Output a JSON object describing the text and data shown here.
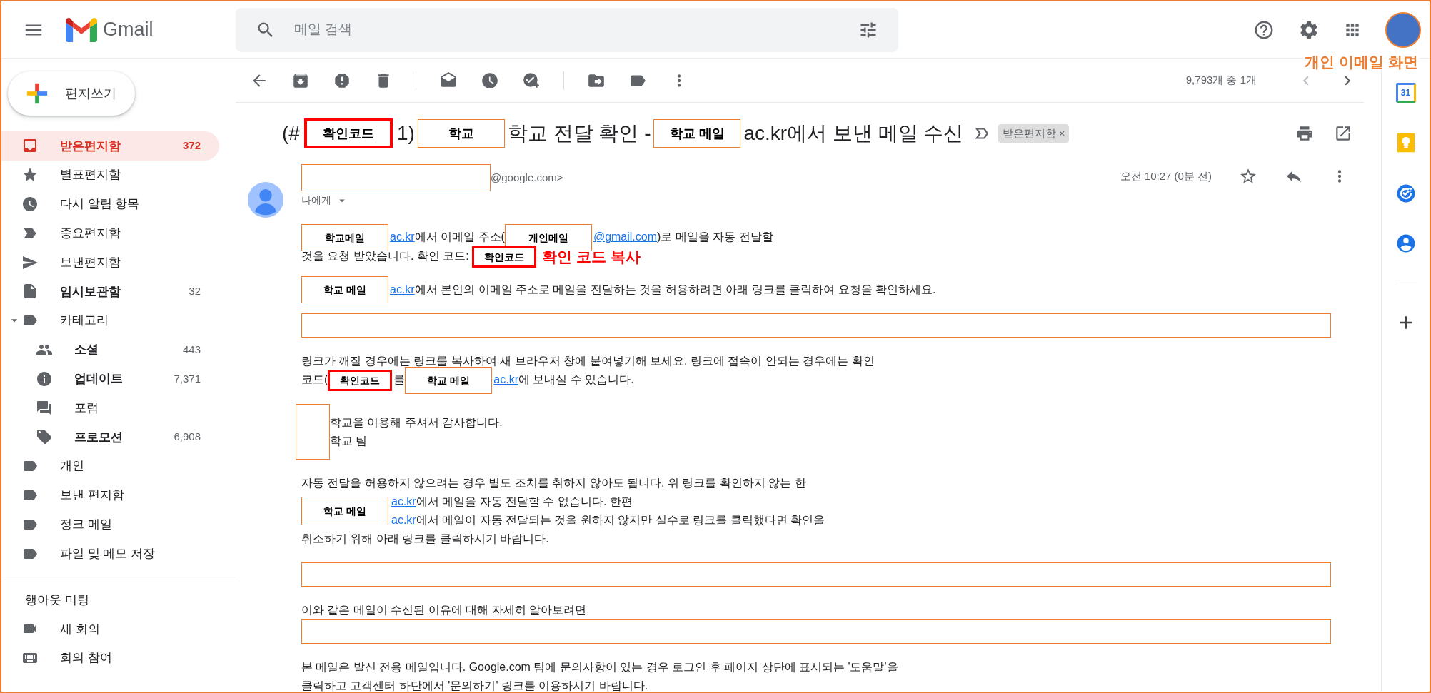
{
  "app": {
    "name": "Gmail"
  },
  "search": {
    "placeholder": "메일 검색"
  },
  "annotation": "개인 이메일 화면",
  "compose": "편지쓰기",
  "nav": [
    {
      "kind": "inbox",
      "label": "받은편지함",
      "count": "372",
      "selected": true,
      "unread": true
    },
    {
      "kind": "starred",
      "label": "별표편지함",
      "selected": false,
      "unread": false
    },
    {
      "kind": "snoozed",
      "label": "다시 알림 항목",
      "selected": false,
      "unread": false
    },
    {
      "kind": "important",
      "label": "중요편지함",
      "selected": false,
      "unread": false
    },
    {
      "kind": "sent",
      "label": "보낸편지함",
      "selected": false,
      "unread": false
    },
    {
      "kind": "drafts",
      "label": "임시보관함",
      "count": "32",
      "selected": false,
      "unread": true
    },
    {
      "kind": "category",
      "label": "카테고리",
      "selected": false,
      "unread": false,
      "expanded": true,
      "children": [
        {
          "kind": "social",
          "label": "소셜",
          "count": "443",
          "selected": false,
          "unread": true
        },
        {
          "kind": "updates",
          "label": "업데이트",
          "count": "7,371",
          "selected": false,
          "unread": true
        },
        {
          "kind": "forums",
          "label": "포럼",
          "selected": false,
          "unread": false
        },
        {
          "kind": "promotions",
          "label": "프로모션",
          "count": "6,908",
          "selected": false,
          "unread": true
        }
      ]
    },
    {
      "kind": "label",
      "label": "개인",
      "selected": false,
      "unread": false
    },
    {
      "kind": "label",
      "label": "보낸 편지함",
      "selected": false,
      "unread": false
    },
    {
      "kind": "label",
      "label": "정크 메일",
      "selected": false,
      "unread": false
    },
    {
      "kind": "label",
      "label": "파일 및 메모 저장",
      "selected": false,
      "unread": false
    }
  ],
  "meet": {
    "title": "행아웃 미팅",
    "items": [
      {
        "kind": "video",
        "label": "새 회의"
      },
      {
        "kind": "keyboard",
        "label": "회의 참여"
      }
    ]
  },
  "toolbar": {
    "count": "9,793개 중 1개"
  },
  "subject": {
    "pieces": [
      {
        "kind": "text",
        "text": "(#"
      },
      {
        "kind": "code",
        "text": "확인코드"
      },
      {
        "kind": "text",
        "text": "1)"
      },
      {
        "kind": "redact",
        "text": "학교"
      },
      {
        "kind": "text",
        "text": "학교 전달 확인 -"
      },
      {
        "kind": "redact",
        "text": "학교 메일"
      },
      {
        "kind": "text",
        "text": "ac.kr에서 보낸 메일 수신"
      }
    ],
    "chip": {
      "label": "받은편지함",
      "remove": "×"
    }
  },
  "message": {
    "sender": [
      {
        "kind": "blank"
      },
      {
        "kind": "text",
        "text": "@google.com>"
      }
    ],
    "to": "나에게",
    "time": "오전 10:27 (0분 전)",
    "starred": false
  },
  "calendar_day": "31",
  "paragraphs": [
    [
      {
        "kind": "lines",
        "lines": [
          [
            {
              "kind": "redact",
              "text": "학교메일"
            },
            {
              "kind": "link",
              "text": "ac.kr"
            },
            {
              "kind": "text",
              "text": "에서 이메일 주소("
            },
            {
              "kind": "redact",
              "text": "개인메일"
            },
            {
              "kind": "link",
              "text": "@gmail.com"
            },
            {
              "kind": "text",
              "text": ")로 메일을 자동 전달할"
            }
          ],
          [
            {
              "kind": "text",
              "text": "것을 요청 받았습니다. 확인 코드: "
            },
            {
              "kind": "code",
              "text": "확인코드"
            },
            {
              "kind": "note",
              "text": "확인 코드 복사"
            }
          ]
        ]
      }
    ],
    [
      {
        "kind": "lines",
        "lines": [
          [
            {
              "kind": "redact",
              "text": "학교 메일"
            },
            {
              "kind": "link",
              "text": "ac.kr"
            },
            {
              "kind": "text",
              "text": "에서 본인의 이메일 주소로 메일을 전달하는 것을 허용하려면 아래 링크를 클릭하여 요청을 확인하세요."
            }
          ]
        ]
      }
    ],
    [
      {
        "kind": "blank"
      }
    ],
    [
      {
        "kind": "lines",
        "lines": [
          [
            {
              "kind": "text",
              "text": "링크가 깨질 경우에는 링크를 복사하여 새 브라우저 창에 붙여넣기해 보세요. 링크에 접속이 안되는 경우에는 확인"
            }
          ],
          [
            {
              "kind": "text",
              "text": "코드("
            },
            {
              "kind": "code",
              "text": "확인코드"
            },
            {
              "kind": "text",
              "text": "를"
            },
            {
              "kind": "redact",
              "text": "학교 메일"
            },
            {
              "kind": "link",
              "text": "ac.kr"
            },
            {
              "kind": "text",
              "text": "에 보내실 수 있습니다."
            }
          ]
        ]
      }
    ],
    [
      {
        "kind": "side",
        "box": {
          "kind": "blank"
        },
        "lines": [
          [
            {
              "kind": "text",
              "text": "학교을 이용해 주셔서 감사합니다."
            }
          ],
          [
            {
              "kind": "text",
              "text": "학교 팀"
            }
          ]
        ]
      }
    ],
    [
      {
        "kind": "lines",
        "lines": [
          [
            {
              "kind": "text",
              "text": "자동 전달을 허용하지 않으려는 경우 별도 조치를 취하지 않아도 됩니다. 위 링크를 확인하지 않는 한"
            }
          ]
        ]
      },
      {
        "kind": "side",
        "box": {
          "kind": "redact",
          "text": "학교 메일"
        },
        "lines": [
          [
            {
              "kind": "link",
              "text": "ac.kr"
            },
            {
              "kind": "text",
              "text": "에서 메일을 자동 전달할 수 없습니다. 한편"
            }
          ],
          [
            {
              "kind": "link",
              "text": "ac.kr"
            },
            {
              "kind": "text",
              "text": "에서 메일이 자동 전달되는 것을 원하지 않지만 실수로 링크를 클릭했다면 확인을"
            }
          ]
        ]
      },
      {
        "kind": "lines",
        "lines": [
          [
            {
              "kind": "text",
              "text": "취소하기 위해 아래 링크를 클릭하시기 바랍니다."
            }
          ]
        ]
      }
    ],
    [
      {
        "kind": "blank"
      }
    ],
    [
      {
        "kind": "lines",
        "lines": [
          [
            {
              "kind": "text",
              "text": "이와 같은 메일이 수신된 이유에 대해 자세히 알아보려면"
            }
          ]
        ]
      },
      {
        "kind": "blank"
      }
    ],
    [
      {
        "kind": "lines",
        "lines": [
          [
            {
              "kind": "text",
              "text": "본 메일은 발신 전용 메일입니다. Google.com 팀에 문의사항이 있는 경우 로그인 후 페이지 상단에 표시되는 '도움말'을"
            }
          ],
          [
            {
              "kind": "text",
              "text": "클릭하고 고객센터 하단에서 '문의하기' 링크를 이용하시기 바랍니다."
            }
          ]
        ]
      }
    ]
  ]
}
